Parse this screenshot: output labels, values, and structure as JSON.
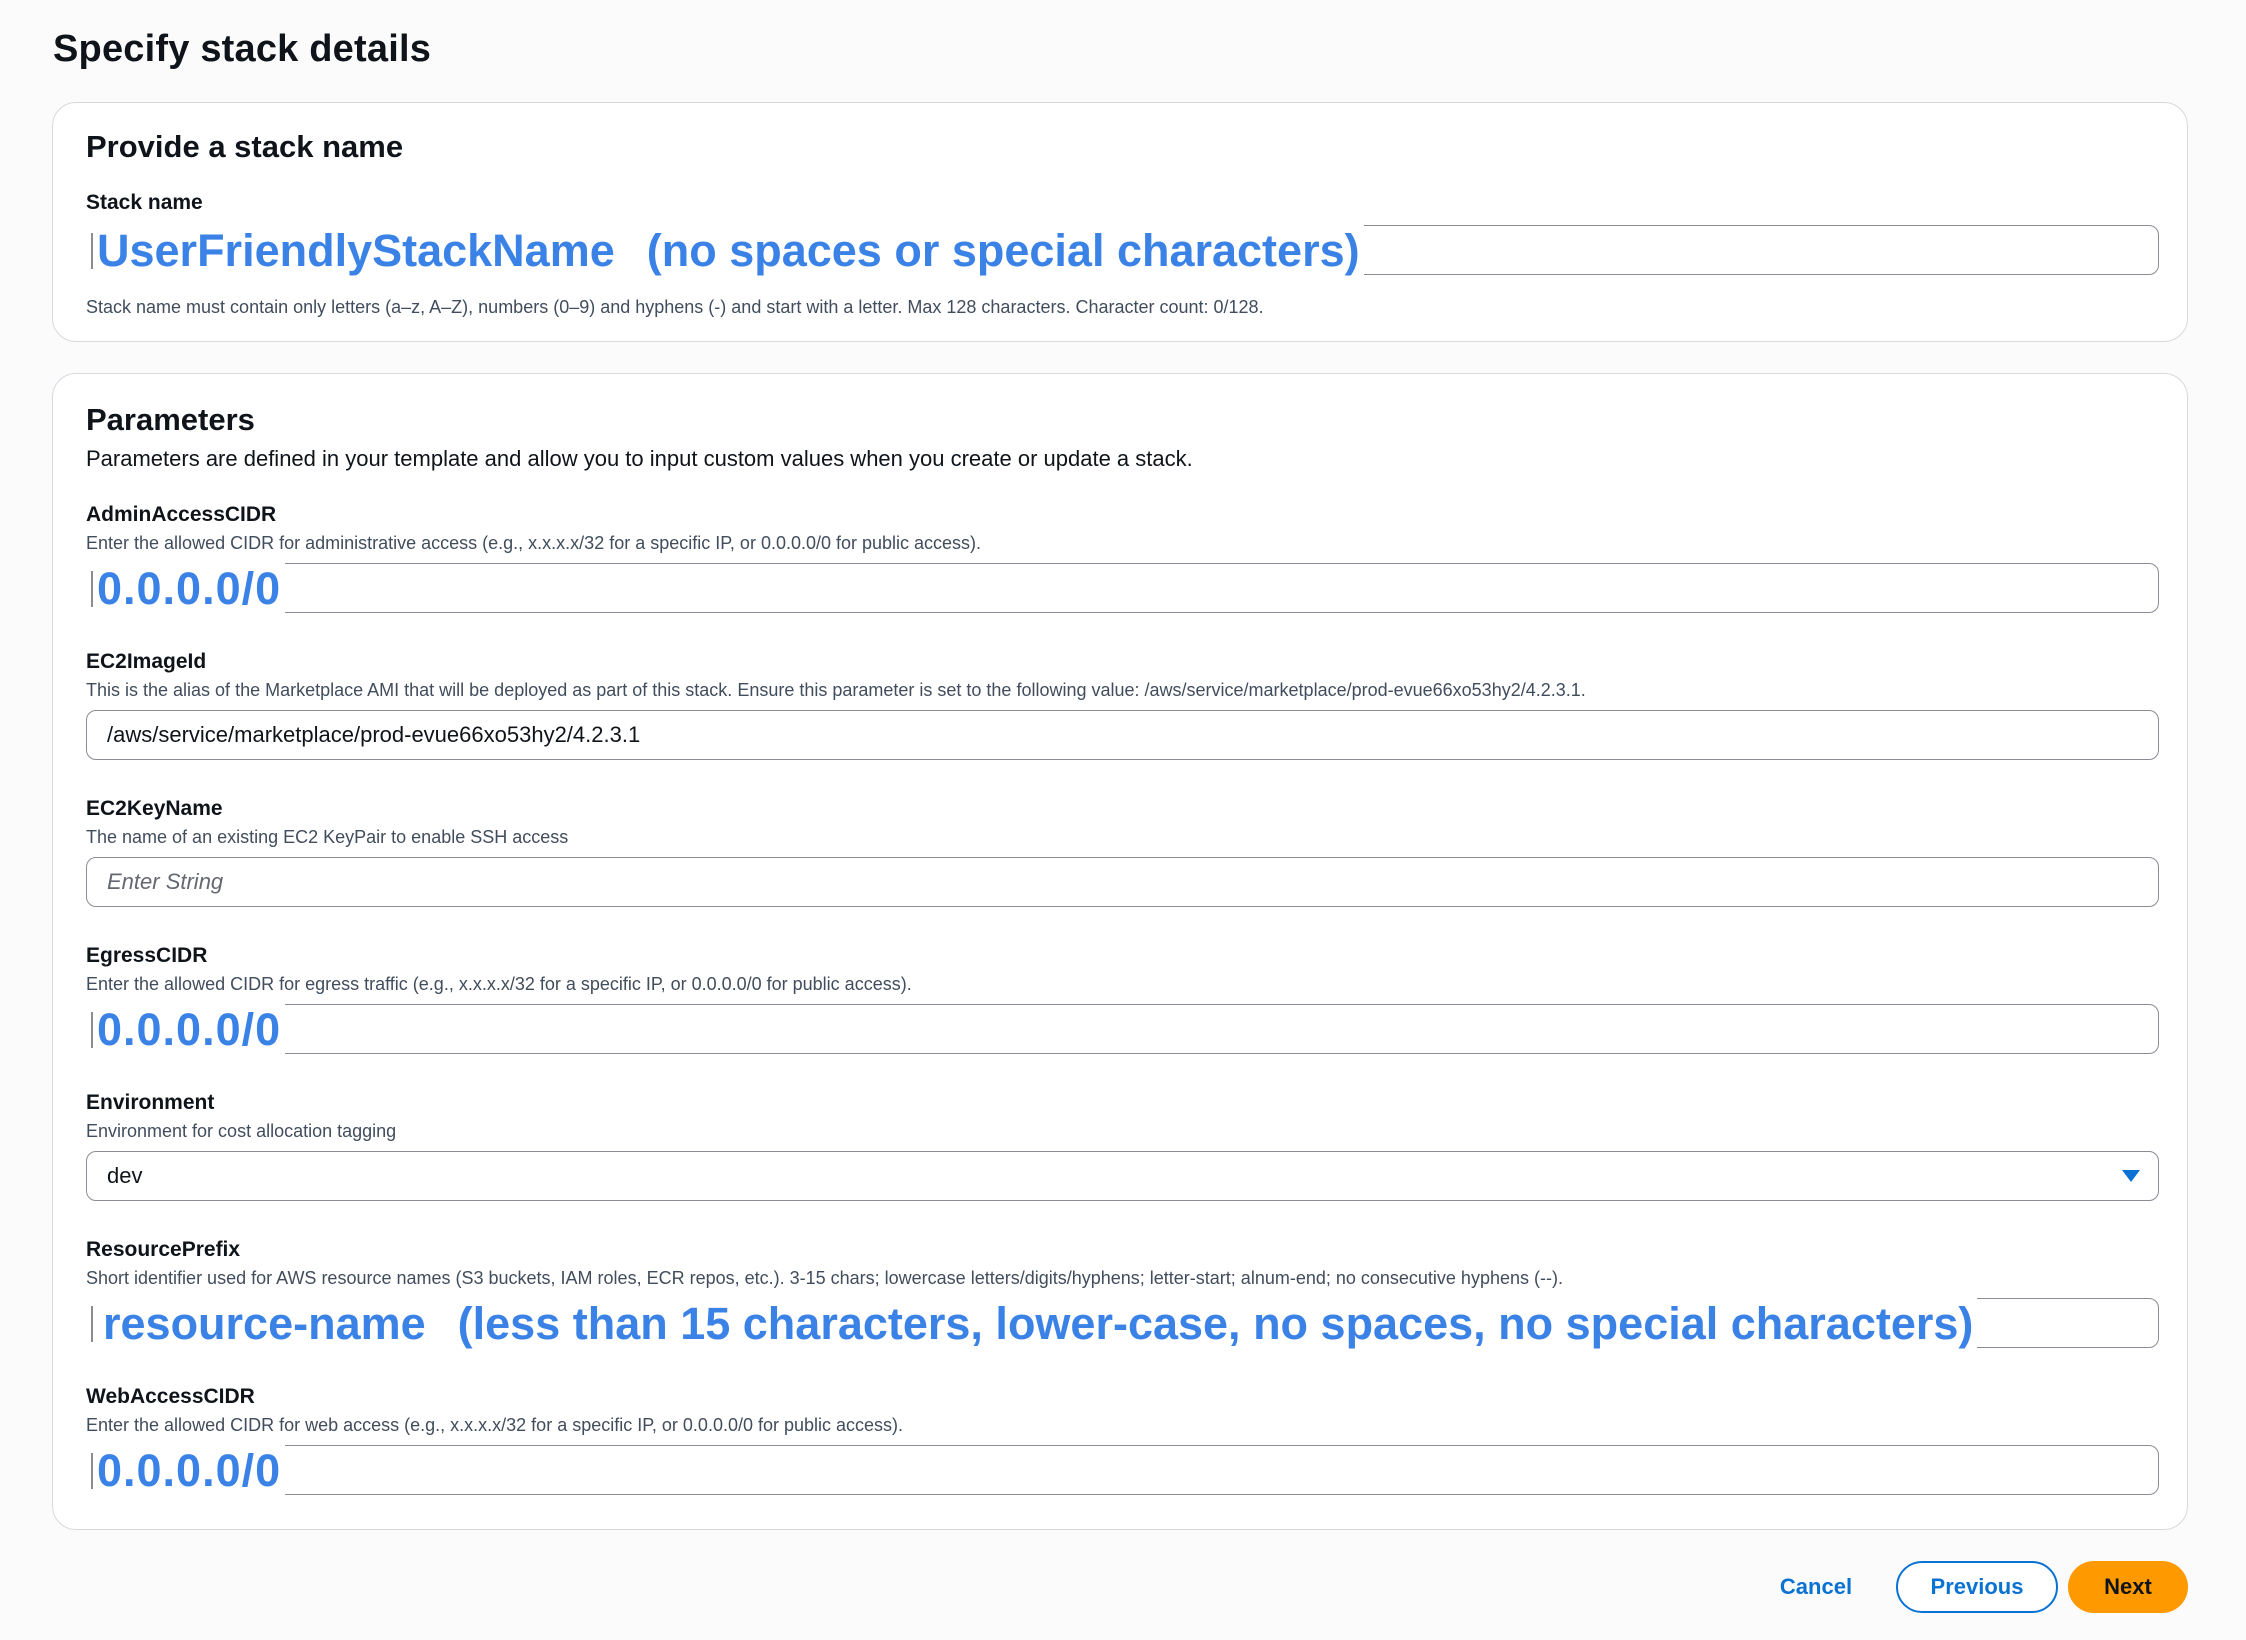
{
  "page": {
    "title": "Specify stack details"
  },
  "stack_section": {
    "heading": "Provide a stack name",
    "label": "Stack name",
    "value": "UserFriendlyStackName",
    "note": "(no spaces or special characters)",
    "constraint": "Stack name must contain only letters (a–z, A–Z), numbers (0–9) and hyphens (-) and start with a letter. Max 128 characters. Character count: 0/128."
  },
  "parameters_section": {
    "heading": "Parameters",
    "description": "Parameters are defined in your template and allow you to input custom values when you create or update a stack.",
    "fields": [
      {
        "label": "AdminAccessCIDR",
        "description": "Enter the allowed CIDR for administrative access (e.g., x.x.x.x/32 for a specific IP, or 0.0.0.0/0 for public access).",
        "value": "0.0.0.0/0"
      },
      {
        "label": "EC2ImageId",
        "description": "This is the alias of the Marketplace AMI that will be deployed as part of this stack. Ensure this parameter is set to the following value: /aws/service/marketplace/prod-evue66xo53hy2/4.2.3.1.",
        "value": "/aws/service/marketplace/prod-evue66xo53hy2/4.2.3.1"
      },
      {
        "label": "EC2KeyName",
        "description": "The name of an existing EC2 KeyPair to enable SSH access",
        "placeholder": "Enter String"
      },
      {
        "label": "EgressCIDR",
        "description": "Enter the allowed CIDR for egress traffic (e.g., x.x.x.x/32 for a specific IP, or 0.0.0.0/0 for public access).",
        "value": "0.0.0.0/0"
      },
      {
        "label": "Environment",
        "description": "Environment for cost allocation tagging",
        "value": "dev"
      },
      {
        "label": "ResourcePrefix",
        "description": "Short identifier used for AWS resource names (S3 buckets, IAM roles, ECR repos, etc.). 3-15 chars; lowercase letters/digits/hyphens; letter-start; alnum-end; no consecutive hyphens (--).",
        "value": "resource-name",
        "note": "(less than 15 characters, lower-case, no spaces, no special characters)"
      },
      {
        "label": "WebAccessCIDR",
        "description": "Enter the allowed CIDR for web access (e.g., x.x.x.x/32 for a specific IP, or 0.0.0.0/0 for public access).",
        "value": "0.0.0.0/0"
      }
    ]
  },
  "footer": {
    "cancel_label": "Cancel",
    "previous_label": "Previous",
    "next_label": "Next"
  },
  "colors": {
    "accent": "#0972d3",
    "primary_button": "#ff9900",
    "annotation": "#3b82e6"
  }
}
